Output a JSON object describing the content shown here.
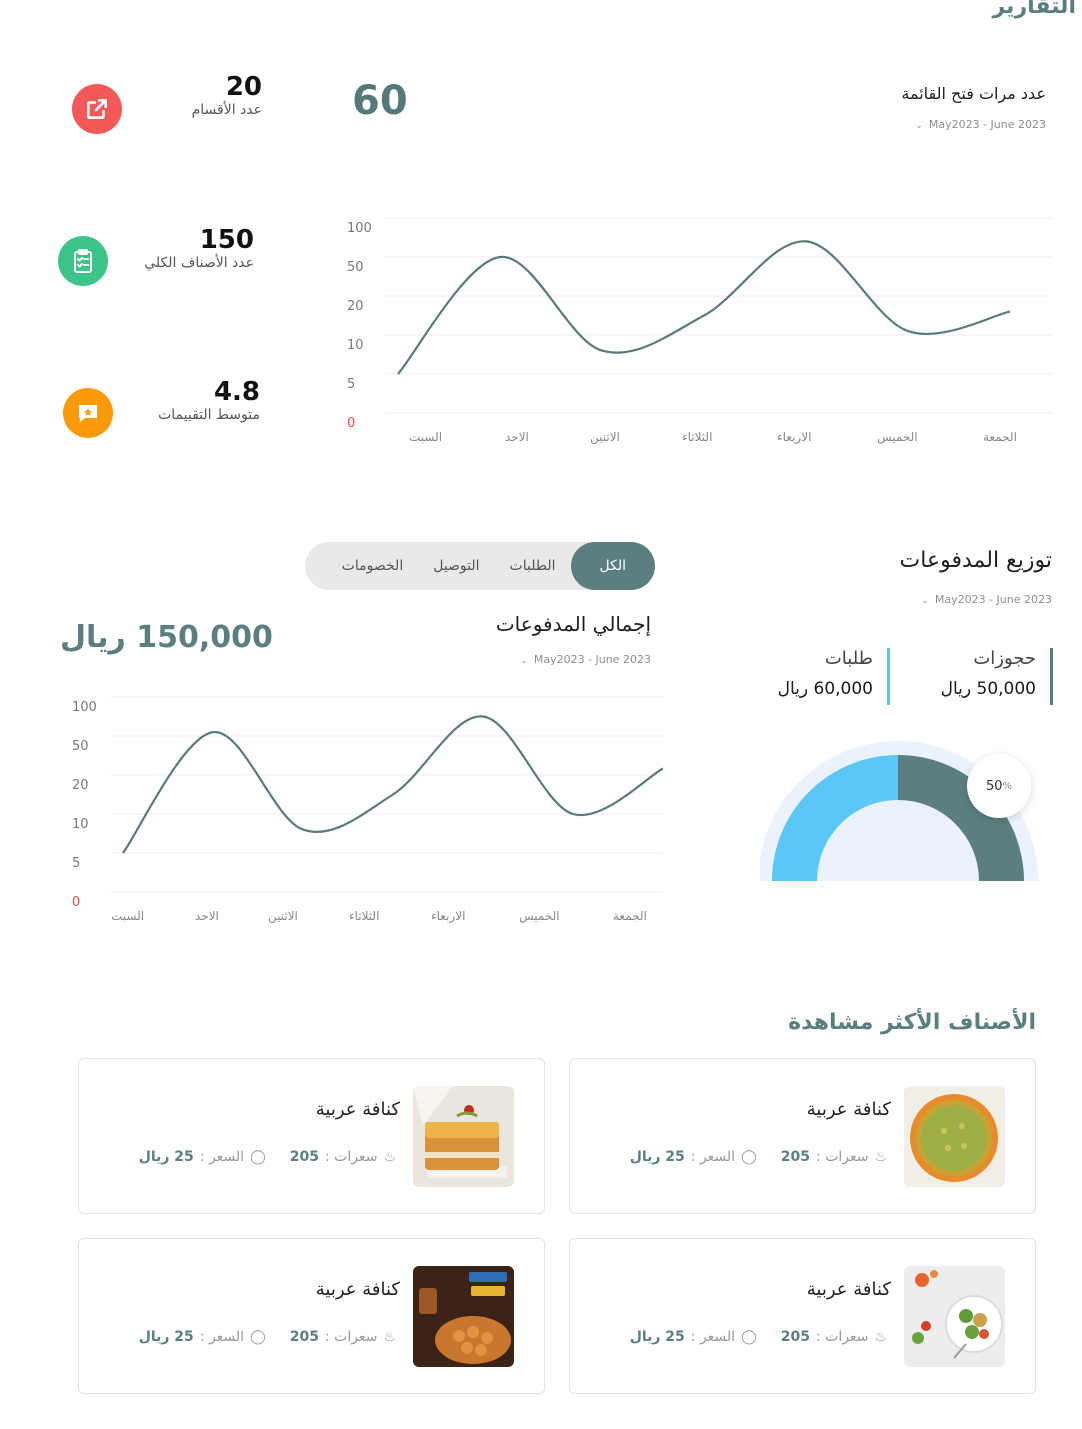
{
  "page_title": "التقارير",
  "menu_views": {
    "title": "عدد مرات فتح القائمة",
    "date_range": "May2023 - June 2023",
    "count": "60"
  },
  "stats": [
    {
      "value": "20",
      "label": "عدد الأقسام",
      "icon": "external-link-icon",
      "color": "#f25a5a"
    },
    {
      "value": "150",
      "label": "عدد الأصناف الكلي",
      "icon": "clipboard-check-icon",
      "color": "#3cc48a"
    },
    {
      "value": "4.8",
      "label": "متوسط التقييمات",
      "icon": "rating-star-message-icon",
      "color": "#fb9b0b"
    }
  ],
  "chart_data": [
    {
      "type": "line",
      "x": [
        "السبت",
        "الاحد",
        "الاثنين",
        "الثلاثاء",
        "الاربعاء",
        "الخميس",
        "الجمعة"
      ],
      "y_ticks": [
        "100",
        "50",
        "20",
        "10",
        "5",
        "0"
      ],
      "series": [
        {
          "values": [
            5,
            50,
            8,
            15,
            70,
            11,
            16
          ]
        }
      ],
      "color": "#5b7a7c",
      "grid": true
    },
    {
      "type": "line",
      "x": [
        "السبت",
        "الاحد",
        "الاثنين",
        "الثلاثاء",
        "الاربعاء",
        "الخميس",
        "الجمعة"
      ],
      "y_ticks": [
        "100",
        "50",
        "20",
        "10",
        "5",
        "0"
      ],
      "series": [
        {
          "values": [
            5,
            55,
            8,
            15,
            75,
            10,
            25
          ]
        }
      ],
      "color": "#5b7a7c",
      "grid": true
    },
    {
      "type": "pie",
      "categories": [
        "حجوزات",
        "طلبات"
      ],
      "values": [
        50,
        50
      ],
      "colors": [
        "#5b7e80",
        "#5bc7f7"
      ],
      "percent_label": "50%"
    }
  ],
  "payments": {
    "tabs": [
      "الكل",
      "الطلبات",
      "التوصيل",
      "الخصومات"
    ],
    "active_tab": 0,
    "title": "إجمالي المدفوعات",
    "date_range": "May2023 - June 2023",
    "total": "150,000 ريال"
  },
  "distribution": {
    "title": "توزيع المدفوعات",
    "date_range": "May2023 - June 2023",
    "items": [
      {
        "label": "حجوزات",
        "amount": "50,000 ريال"
      },
      {
        "label": "طلبات",
        "amount": "60,000 ريال"
      }
    ],
    "percent_number": "50",
    "percent_sign": "%"
  },
  "most_viewed": {
    "title": "الأصناف الأكثر مشاهدة",
    "items": [
      {
        "name": "كنافة عربية",
        "calories_label": "سعرات",
        "calories": "205",
        "price_label": "السعر",
        "price": "25 ريال",
        "image": "kunafa-round"
      },
      {
        "name": "كنافة عربية",
        "calories_label": "سعرات",
        "calories": "205",
        "price_label": "السعر",
        "price": "25 ريال",
        "image": "kunafa-square"
      },
      {
        "name": "كنافة عربية",
        "calories_label": "سعرات",
        "calories": "205",
        "price_label": "السعر",
        "price": "25 ريال",
        "image": "salad-bowl"
      },
      {
        "name": "كنافة عربية",
        "calories_label": "سعرات",
        "calories": "205",
        "price_label": "السعر",
        "price": "25 ريال",
        "image": "caramel-sweets"
      }
    ]
  }
}
